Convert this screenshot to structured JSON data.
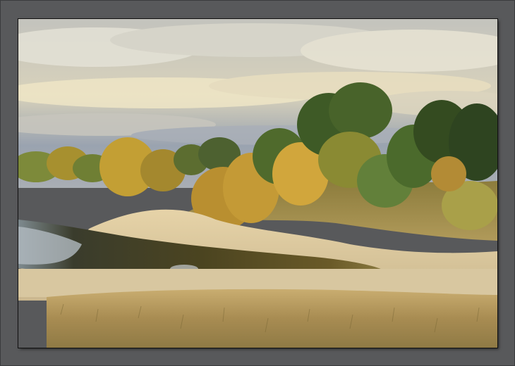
{
  "scene": {
    "subject": "autumn-landscape",
    "elements": [
      "sky",
      "clouds",
      "trees",
      "pond",
      "sand-dune",
      "grass"
    ]
  },
  "colors": {
    "frame": "#58595b",
    "sky_top": "#b8bcc4",
    "sky_bottom": "#8c98a8",
    "cloud_light": "#f0ead2",
    "foliage_gold": "#c9a03a",
    "foliage_green": "#4f6a2c",
    "foliage_dark": "#2e3f1c",
    "sand": "#dcc9a0",
    "water_dark": "#2e3326",
    "water_light": "#b9c0c6",
    "grass": "#b89a5c"
  }
}
